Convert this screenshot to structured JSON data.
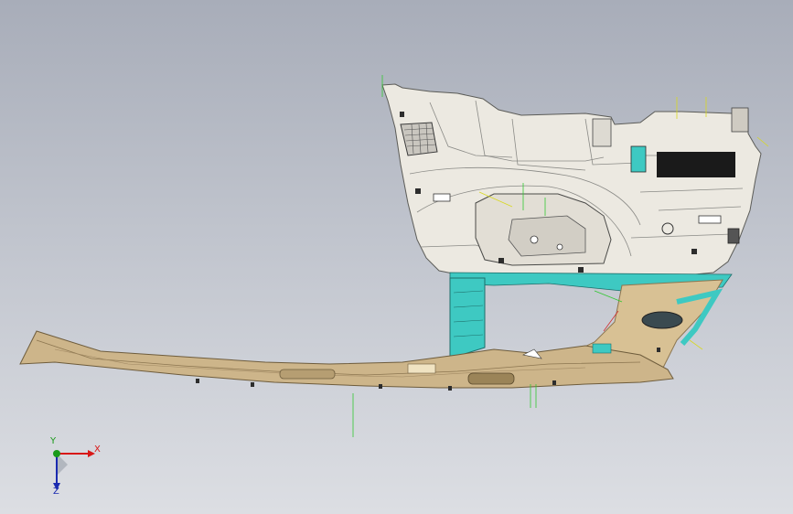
{
  "viewport": {
    "background_top": "#a8adb9",
    "background_bottom": "#dcdee3"
  },
  "model": {
    "part_colors": {
      "panel": "#ece9e1",
      "panel_edge": "#6a6a66",
      "trim_tan": "#cdb58a",
      "trim_tan_dark": "#8c7650",
      "clip_cyan": "#3ec9c2",
      "vent_dark": "#3a3a3a",
      "construction_line_green": "#32c832",
      "construction_line_yellow": "#d8d820",
      "construction_line_red": "#d03030"
    }
  },
  "axis_triad": {
    "x_label": "X",
    "y_label": "Y",
    "z_label": "Z",
    "x_color": "#d81818",
    "y_color": "#1a9a1a",
    "z_color": "#1a2ab0"
  }
}
